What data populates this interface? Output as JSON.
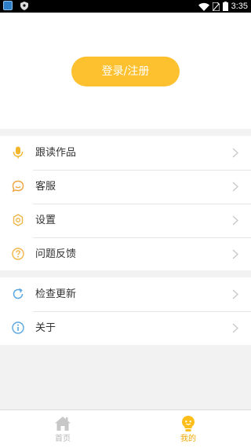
{
  "status_bar": {
    "time": "3:35",
    "icons": [
      "app-icon",
      "shield-icon",
      "wifi-icon",
      "no-sim-icon",
      "battery-icon"
    ]
  },
  "header": {
    "login_button_label": "登录/注册",
    "accent_color": "#fdc02f"
  },
  "menu": {
    "group1": [
      {
        "label": "跟读作品",
        "icon": "microphone-icon",
        "icon_color": "#f3b52a"
      },
      {
        "label": "客服",
        "icon": "chat-bubble-icon",
        "icon_color": "#f0a23c"
      },
      {
        "label": "设置",
        "icon": "gear-icon",
        "icon_color": "#f0b648"
      },
      {
        "label": "问题反馈",
        "icon": "question-icon",
        "icon_color": "#f0b648"
      }
    ],
    "group2": [
      {
        "label": "检查更新",
        "icon": "refresh-icon",
        "icon_color": "#5aa6e0"
      },
      {
        "label": "关于",
        "icon": "info-icon",
        "icon_color": "#5aa6e0"
      }
    ]
  },
  "bottom_nav": {
    "items": [
      {
        "label": "首页",
        "icon": "home-icon",
        "active": false
      },
      {
        "label": "我的",
        "icon": "profile-bulb-icon",
        "active": true
      }
    ],
    "active_color": "#f0a800",
    "inactive_color": "#b8b8b8"
  }
}
